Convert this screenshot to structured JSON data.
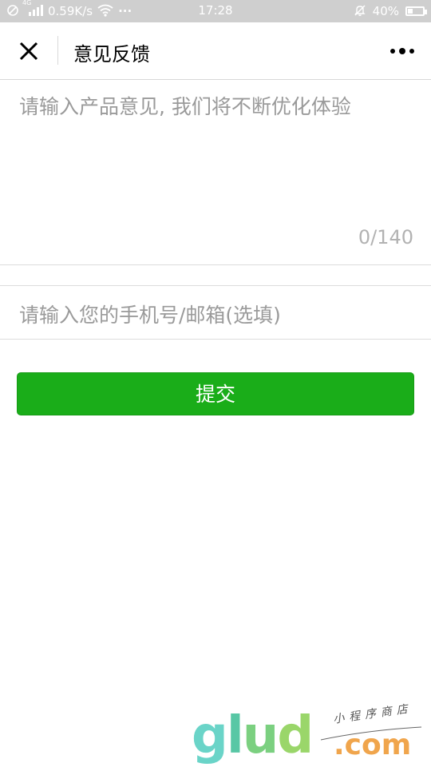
{
  "status_bar": {
    "network_type": "4G",
    "speed": "0.59K/s",
    "more": "···",
    "time": "17:28",
    "battery": "40%",
    "battery_level": 0.4
  },
  "nav": {
    "title": "意见反馈"
  },
  "feedback": {
    "placeholder": "请输入产品意见, 我们将不断优化体验",
    "char_count": "0/140"
  },
  "contact": {
    "placeholder": "请输入您的手机号/邮箱(选填)"
  },
  "submit": {
    "label": "提交"
  },
  "watermark": {
    "logo_letters": [
      "g",
      "l",
      "u",
      "d"
    ],
    "dotcom": ".com",
    "tagline": "小程序商店"
  },
  "colors": {
    "primary_button": "#1aad19",
    "placeholder_text": "#9a9a9a",
    "status_bar_bg": "#cfcfcf"
  }
}
